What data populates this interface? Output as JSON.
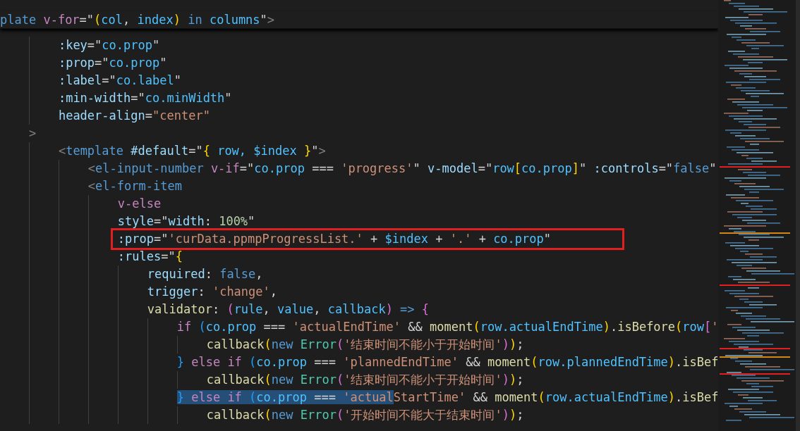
{
  "sticky_line": {
    "tokens": [
      {
        "text": "plate ",
        "kind": "tag"
      },
      {
        "text": "v-for",
        "kind": "kw"
      },
      {
        "text": "=\"",
        "kind": "text"
      },
      {
        "text": "(",
        "kind": "b1"
      },
      {
        "text": "col",
        "kind": "var"
      },
      {
        "text": ", ",
        "kind": "text"
      },
      {
        "text": "index",
        "kind": "var"
      },
      {
        "text": ")",
        "kind": "b1"
      },
      {
        "text": " in ",
        "kind": "kwb"
      },
      {
        "text": "columns",
        "kind": "var"
      },
      {
        "text": "\"",
        "kind": "text"
      },
      {
        "text": ">",
        "kind": "tagp"
      }
    ]
  },
  "lines": [
    {
      "tokens": [
        {
          "text": "        :key",
          "kind": "attr"
        },
        {
          "text": "=\"",
          "kind": "text"
        },
        {
          "text": "co.prop",
          "kind": "var"
        },
        {
          "text": "\"",
          "kind": "text"
        }
      ]
    },
    {
      "tokens": [
        {
          "text": "        :prop",
          "kind": "attr"
        },
        {
          "text": "=\"",
          "kind": "text"
        },
        {
          "text": "co.prop",
          "kind": "var"
        },
        {
          "text": "\"",
          "kind": "text"
        }
      ]
    },
    {
      "tokens": [
        {
          "text": "        :label",
          "kind": "attr"
        },
        {
          "text": "=\"",
          "kind": "text"
        },
        {
          "text": "co.label",
          "kind": "var"
        },
        {
          "text": "\"",
          "kind": "text"
        }
      ]
    },
    {
      "tokens": [
        {
          "text": "        :min-width",
          "kind": "attr"
        },
        {
          "text": "=\"",
          "kind": "text"
        },
        {
          "text": "co.minWidth",
          "kind": "var"
        },
        {
          "text": "\"",
          "kind": "text"
        }
      ]
    },
    {
      "tokens": [
        {
          "text": "        header-align",
          "kind": "attr"
        },
        {
          "text": "=",
          "kind": "text"
        },
        {
          "text": "\"center\"",
          "kind": "str"
        }
      ]
    },
    {
      "tokens": [
        {
          "text": "    >",
          "kind": "tagp"
        }
      ]
    },
    {
      "tokens": [
        {
          "text": "        <",
          "kind": "tagp"
        },
        {
          "text": "template",
          "kind": "tag"
        },
        {
          "text": " #default",
          "kind": "attr"
        },
        {
          "text": "=\"",
          "kind": "text"
        },
        {
          "text": "{",
          "kind": "b1"
        },
        {
          "text": " row, $index ",
          "kind": "var"
        },
        {
          "text": "}",
          "kind": "b1"
        },
        {
          "text": "\"",
          "kind": "text"
        },
        {
          "text": ">",
          "kind": "tagp"
        }
      ]
    },
    {
      "tokens": [
        {
          "text": "            <",
          "kind": "tagp"
        },
        {
          "text": "el-input-number ",
          "kind": "tag"
        },
        {
          "text": "v-if",
          "kind": "kw"
        },
        {
          "text": "=\"",
          "kind": "text"
        },
        {
          "text": "co.prop",
          "kind": "var"
        },
        {
          "text": " === ",
          "kind": "text"
        },
        {
          "text": "'progress'",
          "kind": "str"
        },
        {
          "text": "\" ",
          "kind": "text"
        },
        {
          "text": "v-model",
          "kind": "attr"
        },
        {
          "text": "=\"",
          "kind": "text"
        },
        {
          "text": "row",
          "kind": "var"
        },
        {
          "text": "[",
          "kind": "b1"
        },
        {
          "text": "co.prop",
          "kind": "var"
        },
        {
          "text": "]",
          "kind": "b1"
        },
        {
          "text": "\" ",
          "kind": "text"
        },
        {
          "text": ":controls",
          "kind": "attr"
        },
        {
          "text": "=\"",
          "kind": "text"
        },
        {
          "text": "false",
          "kind": "kwb"
        },
        {
          "text": "\"",
          "kind": "text"
        }
      ]
    },
    {
      "tokens": [
        {
          "text": "            <",
          "kind": "tagp"
        },
        {
          "text": "el-form-item",
          "kind": "tag"
        }
      ]
    },
    {
      "tokens": [
        {
          "text": "                v-else",
          "kind": "kw"
        }
      ]
    },
    {
      "tokens": [
        {
          "text": "                style",
          "kind": "attr"
        },
        {
          "text": "=\"",
          "kind": "text"
        },
        {
          "text": "width",
          "kind": "attr"
        },
        {
          "text": ": ",
          "kind": "text"
        },
        {
          "text": "100%",
          "kind": "num"
        },
        {
          "text": "\"",
          "kind": "text"
        }
      ]
    },
    {
      "boxed": true,
      "tokens": [
        {
          "text": "                :prop",
          "kind": "attr"
        },
        {
          "text": "=\"",
          "kind": "text"
        },
        {
          "text": "'curData.ppmpProgressList.'",
          "kind": "str"
        },
        {
          "text": " + ",
          "kind": "text"
        },
        {
          "text": "$index",
          "kind": "var"
        },
        {
          "text": " + ",
          "kind": "text"
        },
        {
          "text": "'.'",
          "kind": "str"
        },
        {
          "text": " + ",
          "kind": "text"
        },
        {
          "text": "co.prop",
          "kind": "var"
        },
        {
          "text": "\"",
          "kind": "text"
        }
      ]
    },
    {
      "tokens": [
        {
          "text": "                :rules",
          "kind": "attr"
        },
        {
          "text": "=\"",
          "kind": "text"
        },
        {
          "text": "{",
          "kind": "b1"
        }
      ]
    },
    {
      "tokens": [
        {
          "text": "                    required",
          "kind": "attr"
        },
        {
          "text": ": ",
          "kind": "text"
        },
        {
          "text": "false",
          "kind": "kwb"
        },
        {
          "text": ",",
          "kind": "text"
        }
      ]
    },
    {
      "tokens": [
        {
          "text": "                    trigger",
          "kind": "attr"
        },
        {
          "text": ": ",
          "kind": "text"
        },
        {
          "text": "'change'",
          "kind": "str"
        },
        {
          "text": ",",
          "kind": "text"
        }
      ]
    },
    {
      "tokens": [
        {
          "text": "                    validator",
          "kind": "fn"
        },
        {
          "text": ": ",
          "kind": "text"
        },
        {
          "text": "(",
          "kind": "b2"
        },
        {
          "text": "rule",
          "kind": "var"
        },
        {
          "text": ", ",
          "kind": "text"
        },
        {
          "text": "value",
          "kind": "var"
        },
        {
          "text": ", ",
          "kind": "text"
        },
        {
          "text": "callback",
          "kind": "var"
        },
        {
          "text": ")",
          "kind": "b2"
        },
        {
          "text": " => ",
          "kind": "kwb"
        },
        {
          "text": "{",
          "kind": "b2"
        }
      ]
    },
    {
      "tokens": [
        {
          "text": "                        if ",
          "kind": "kw"
        },
        {
          "text": "(",
          "kind": "b3"
        },
        {
          "text": "co.prop",
          "kind": "var"
        },
        {
          "text": " === ",
          "kind": "text"
        },
        {
          "text": "'actualEndTime'",
          "kind": "str"
        },
        {
          "text": " && ",
          "kind": "text"
        },
        {
          "text": "moment",
          "kind": "fn"
        },
        {
          "text": "(",
          "kind": "b1"
        },
        {
          "text": "row.actualEndTime",
          "kind": "var"
        },
        {
          "text": ")",
          "kind": "b1"
        },
        {
          "text": ".",
          "kind": "text"
        },
        {
          "text": "isBefore",
          "kind": "fn"
        },
        {
          "text": "(",
          "kind": "b1"
        },
        {
          "text": "row",
          "kind": "var"
        },
        {
          "text": "[",
          "kind": "b2"
        },
        {
          "text": "'",
          "kind": "str"
        }
      ]
    },
    {
      "tokens": [
        {
          "text": "                            callback",
          "kind": "fn"
        },
        {
          "text": "(",
          "kind": "b1"
        },
        {
          "text": "new ",
          "kind": "kwb"
        },
        {
          "text": "Error",
          "kind": "cls"
        },
        {
          "text": "(",
          "kind": "b2"
        },
        {
          "text": "'结束时间不能小于开始时间'",
          "kind": "str"
        },
        {
          "text": ")",
          "kind": "b2"
        },
        {
          "text": ")",
          "kind": "b1"
        },
        {
          "text": ";",
          "kind": "text"
        }
      ]
    },
    {
      "tokens": [
        {
          "text": "                        }",
          "kind": "b3"
        },
        {
          "text": " else if ",
          "kind": "kw"
        },
        {
          "text": "(",
          "kind": "b3"
        },
        {
          "text": "co.prop",
          "kind": "var"
        },
        {
          "text": " === ",
          "kind": "text"
        },
        {
          "text": "'plannedEndTime'",
          "kind": "str"
        },
        {
          "text": " && ",
          "kind": "text"
        },
        {
          "text": "moment",
          "kind": "fn"
        },
        {
          "text": "(",
          "kind": "b1"
        },
        {
          "text": "row.plannedEndTime",
          "kind": "var"
        },
        {
          "text": ")",
          "kind": "b1"
        },
        {
          "text": ".",
          "kind": "text"
        },
        {
          "text": "isBef",
          "kind": "fn"
        }
      ]
    },
    {
      "tokens": [
        {
          "text": "                            callback",
          "kind": "fn"
        },
        {
          "text": "(",
          "kind": "b1"
        },
        {
          "text": "new ",
          "kind": "kwb"
        },
        {
          "text": "Error",
          "kind": "cls"
        },
        {
          "text": "(",
          "kind": "b2"
        },
        {
          "text": "'结束时间不能小于开始时间'",
          "kind": "str"
        },
        {
          "text": ")",
          "kind": "b2"
        },
        {
          "text": ")",
          "kind": "b1"
        },
        {
          "text": ";",
          "kind": "text"
        }
      ]
    },
    {
      "tokens": [
        {
          "text": "                        }",
          "kind": "b3",
          "selected": true
        },
        {
          "text": " else if ",
          "kind": "kw",
          "selected": true
        },
        {
          "text": "(",
          "kind": "b3",
          "selected": true
        },
        {
          "text": "co.prop",
          "kind": "var",
          "selected": true
        },
        {
          "text": " === ",
          "kind": "text",
          "selected": true
        },
        {
          "text": "'actual",
          "kind": "str",
          "selected": true
        },
        {
          "text": "StartTime'",
          "kind": "str",
          "selected": false
        },
        {
          "text": " && ",
          "kind": "text",
          "selected": false
        },
        {
          "text": "moment",
          "kind": "fn",
          "selected": false
        },
        {
          "text": "(",
          "kind": "b1",
          "selected": false
        },
        {
          "text": "row.actualEndTime",
          "kind": "var",
          "selected": false
        },
        {
          "text": ")",
          "kind": "b1",
          "selected": false
        },
        {
          "text": ".",
          "kind": "text",
          "selected": false
        },
        {
          "text": "isBef",
          "kind": "fn",
          "selected": false
        }
      ]
    },
    {
      "tokens": [
        {
          "text": "                            callback",
          "kind": "fn"
        },
        {
          "text": "(",
          "kind": "b1"
        },
        {
          "text": "new ",
          "kind": "kwb"
        },
        {
          "text": "Error",
          "kind": "cls"
        },
        {
          "text": "(",
          "kind": "b2"
        },
        {
          "text": "'开始时间不能大于结束时间'",
          "kind": "str"
        },
        {
          "text": ")",
          "kind": "b2"
        },
        {
          "text": ")",
          "kind": "b1"
        },
        {
          "text": ";",
          "kind": "text"
        }
      ]
    }
  ]
}
